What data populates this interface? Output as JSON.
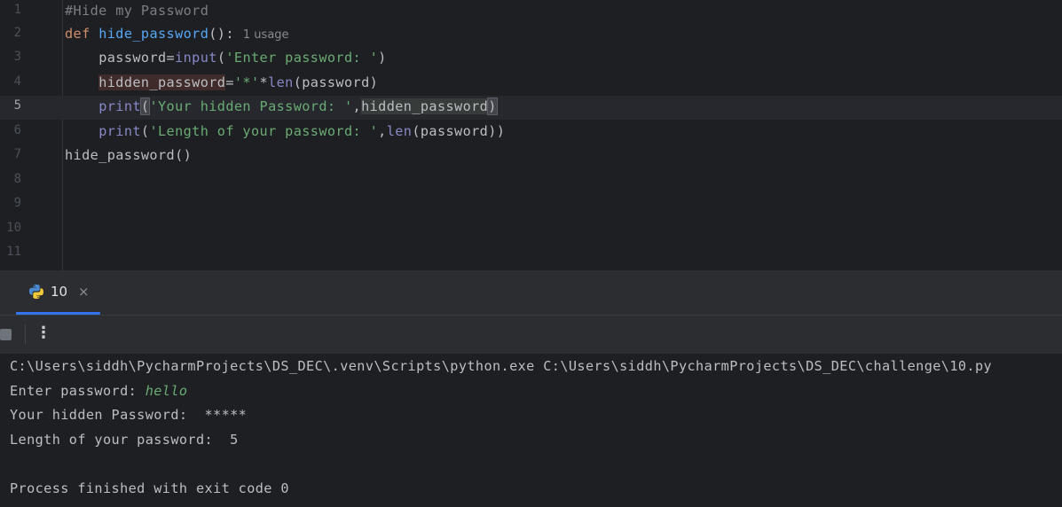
{
  "editor": {
    "line_numbers": [
      "1",
      "2",
      "3",
      "4",
      "5",
      "6",
      "7",
      "8",
      "9",
      "10",
      "11"
    ],
    "current_line": "5",
    "lines": {
      "l1": {
        "comment": "#Hide my Password"
      },
      "l2": {
        "keyword": "def",
        "fn_name": "hide_password",
        "rest": "():",
        "usage_hint": "1 usage"
      },
      "l3": {
        "var": "password",
        "eq": "=",
        "builtin": "input",
        "open": "(",
        "str": "'Enter password: '",
        "close": ")"
      },
      "l4": {
        "var": "hidden_password",
        "eq": "=",
        "str": "'*'",
        "op": "*",
        "builtin": "len",
        "args": "(password)"
      },
      "l5": {
        "builtin": "print",
        "open": "(",
        "str": "'Your hidden Password: '",
        "comma": ",",
        "arg": "hidden_password",
        "close": ")"
      },
      "l6": {
        "builtin": "print",
        "open": "(",
        "str": "'Length of your password: '",
        "comma": ",",
        "builtin2": "len",
        "args": "(password))"
      },
      "l7": {
        "call": "hide_password()"
      }
    }
  },
  "tool_window": {
    "tab_label": "10",
    "tab_close": "×",
    "tab_icon": "python-icon",
    "toolbar": {
      "stop_icon": "stop-icon",
      "more_icon": "more-vertical-icon",
      "more_glyph": "⋮"
    }
  },
  "console": {
    "command": "C:\\Users\\siddh\\PycharmProjects\\DS_DEC\\.venv\\Scripts\\python.exe C:\\Users\\siddh\\PycharmProjects\\DS_DEC\\challenge\\10.py",
    "prompt": "Enter password: ",
    "user_input": "hello",
    "hidden_output": "Your hidden Password:  *****",
    "length_output": "Length of your password:  5",
    "exit_message": "Process finished with exit code 0"
  },
  "colors": {
    "accent": "#3574f0",
    "background": "#1e1f22",
    "panel": "#2b2d30",
    "string": "#6aab73",
    "keyword": "#cf8e6d",
    "function": "#56a8f5",
    "builtin": "#8888c6"
  }
}
